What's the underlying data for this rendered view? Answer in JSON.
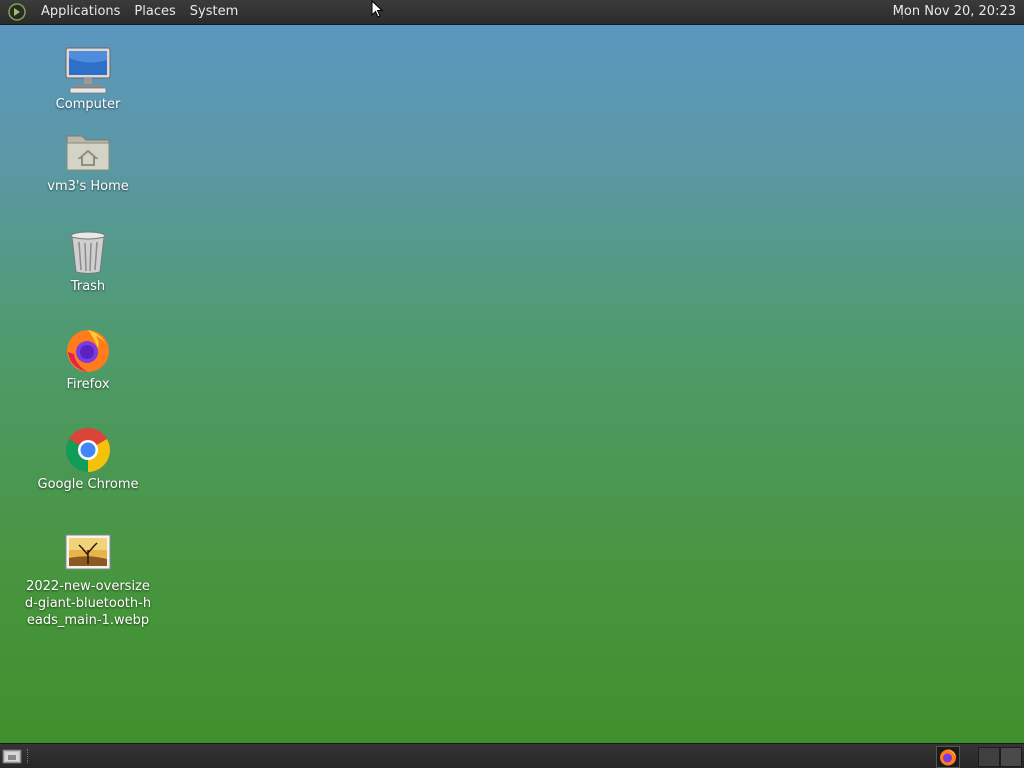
{
  "top_panel": {
    "menus": [
      "Applications",
      "Places",
      "System"
    ],
    "clock": "Mon Nov 20, 20:23"
  },
  "desktop": {
    "icons": [
      {
        "label": "Computer",
        "icon": "computer-icon"
      },
      {
        "label": "vm3's Home",
        "icon": "home-folder-icon"
      },
      {
        "label": "Trash",
        "icon": "trash-icon"
      },
      {
        "label": "Firefox",
        "icon": "firefox-icon"
      },
      {
        "label": "Google Chrome",
        "icon": "chrome-icon"
      },
      {
        "label": "2022-new-oversized-giant-bluetooth-heads_main-1.webp",
        "icon": "image-file-icon"
      }
    ]
  },
  "bottom_panel": {
    "tray": [
      "show-desktop-icon",
      "firefox-icon"
    ],
    "workspaces": 2
  },
  "colors": {
    "panel": "#2e2e2e",
    "desktop_top": "#5b97c4",
    "desktop_bottom": "#3f8f2a"
  }
}
